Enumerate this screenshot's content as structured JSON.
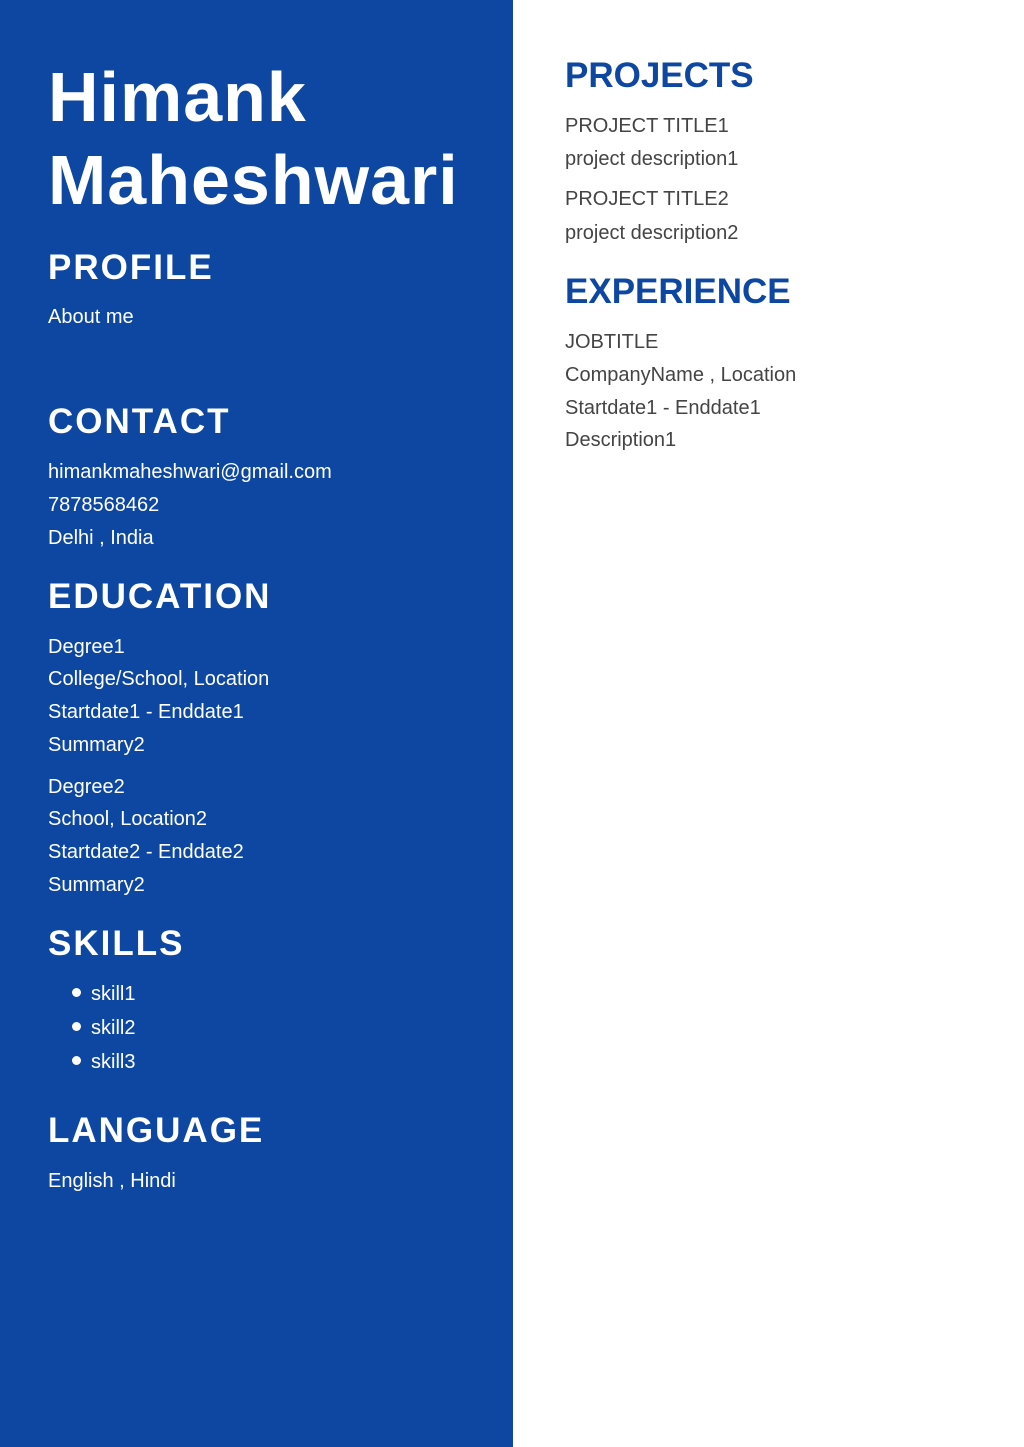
{
  "sidebar": {
    "name_first": "Himank",
    "name_last": "Maheshwari",
    "profile": {
      "heading": "PROFILE",
      "about": "About me"
    },
    "contact": {
      "heading": "CONTACT",
      "email": "himankmaheshwari@gmail.com",
      "phone": "7878568462",
      "location": "Delhi , India"
    },
    "education": {
      "heading": "EDUCATION",
      "items": [
        {
          "degree": "Degree1",
          "school": "College/School, Location",
          "dates": "Startdate1 - Enddate1",
          "summary": "Summary2"
        },
        {
          "degree": "Degree2",
          "school": "School, Location2",
          "dates": "Startdate2 - Enddate2",
          "summary": "Summary2"
        }
      ]
    },
    "skills": {
      "heading": "SKILLS",
      "items": [
        "skill1",
        "skill2",
        "skill3"
      ]
    },
    "language": {
      "heading": "LANGUAGE",
      "text": "English , Hindi"
    }
  },
  "main": {
    "projects": {
      "heading": "PROJECTS",
      "items": [
        {
          "title": "PROJECT TITLE1",
          "description": "project description1"
        },
        {
          "title": "PROJECT TITLE2",
          "description": "project description2"
        }
      ]
    },
    "experience": {
      "heading": "EXPERIENCE",
      "job_title": "JOBTITLE",
      "company": "CompanyName , Location",
      "dates": "Startdate1 - Enddate1",
      "description": "Description1"
    }
  },
  "colors": {
    "sidebar_bg": "#0d47a1",
    "heading_blue": "#0d47a1",
    "body_text": "#444444",
    "sidebar_text": "#ffffff"
  }
}
